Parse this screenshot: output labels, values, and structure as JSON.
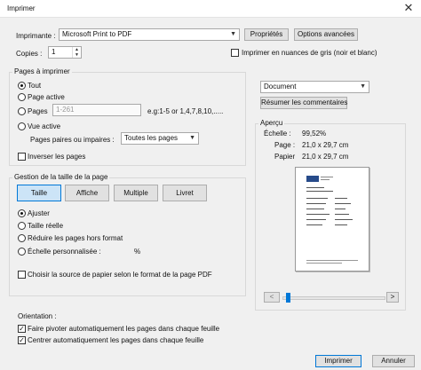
{
  "window": {
    "title": "Imprimer",
    "close": "✕"
  },
  "printer": {
    "label": "Imprimante :",
    "value": "Microsoft Print to PDF",
    "properties_button": "Propriétés",
    "advanced_button": "Options avancées",
    "copies_label": "Copies :",
    "copies_value": "1",
    "grayscale_label": "Imprimer en nuances de gris (noir et blanc)"
  },
  "pages": {
    "group_label": "Pages à imprimer",
    "all_label": "Tout",
    "current_label": "Page active",
    "pages_label": "Pages",
    "pages_input": "1-261",
    "pages_example": "e.g:1-5 or 1,4,7,8,10,.....",
    "view_label": "Vue active",
    "even_odd_label": "Pages paires ou impaires :",
    "even_odd_value": "Toutes les pages",
    "reverse_label": "Inverser les pages"
  },
  "content": {
    "document_select": "Document",
    "summarize_button": "Résumer les commentaires"
  },
  "preview": {
    "group_label": "Aperçu",
    "scale_label": "Échelle :",
    "scale_value": "99,52%",
    "page_label": "Page :",
    "page_value": "21,0 x 29,7 cm",
    "paper_label": "Papier",
    "paper_value": "21,0 x 29,7 cm",
    "prev": "<",
    "next": ">",
    "zoom_slider_fraction": 0.02
  },
  "sizing": {
    "group_label": "Gestion de la taille de la page",
    "tabs": [
      "Taille",
      "Affiche",
      "Multiple",
      "Livret"
    ],
    "adjust_label": "Ajuster",
    "actual_label": "Taille réelle",
    "shrink_label": "Réduire les pages hors format",
    "custom_label": "Échelle personnalisée :",
    "percent": "%",
    "paper_source_label": "Choisir la source de papier selon le format de la page PDF"
  },
  "orientation": {
    "label": "Orientation :",
    "auto_rotate_label": "Faire pivoter automatiquement les pages dans chaque feuille",
    "auto_center_label": "Centrer automatiquement les pages dans chaque feuille"
  },
  "footer": {
    "print_button": "Imprimer",
    "cancel_button": "Annuler"
  },
  "icons": {
    "check": "✓",
    "dropdown": "▼",
    "spin_up": "▲",
    "spin_down": "▼"
  }
}
